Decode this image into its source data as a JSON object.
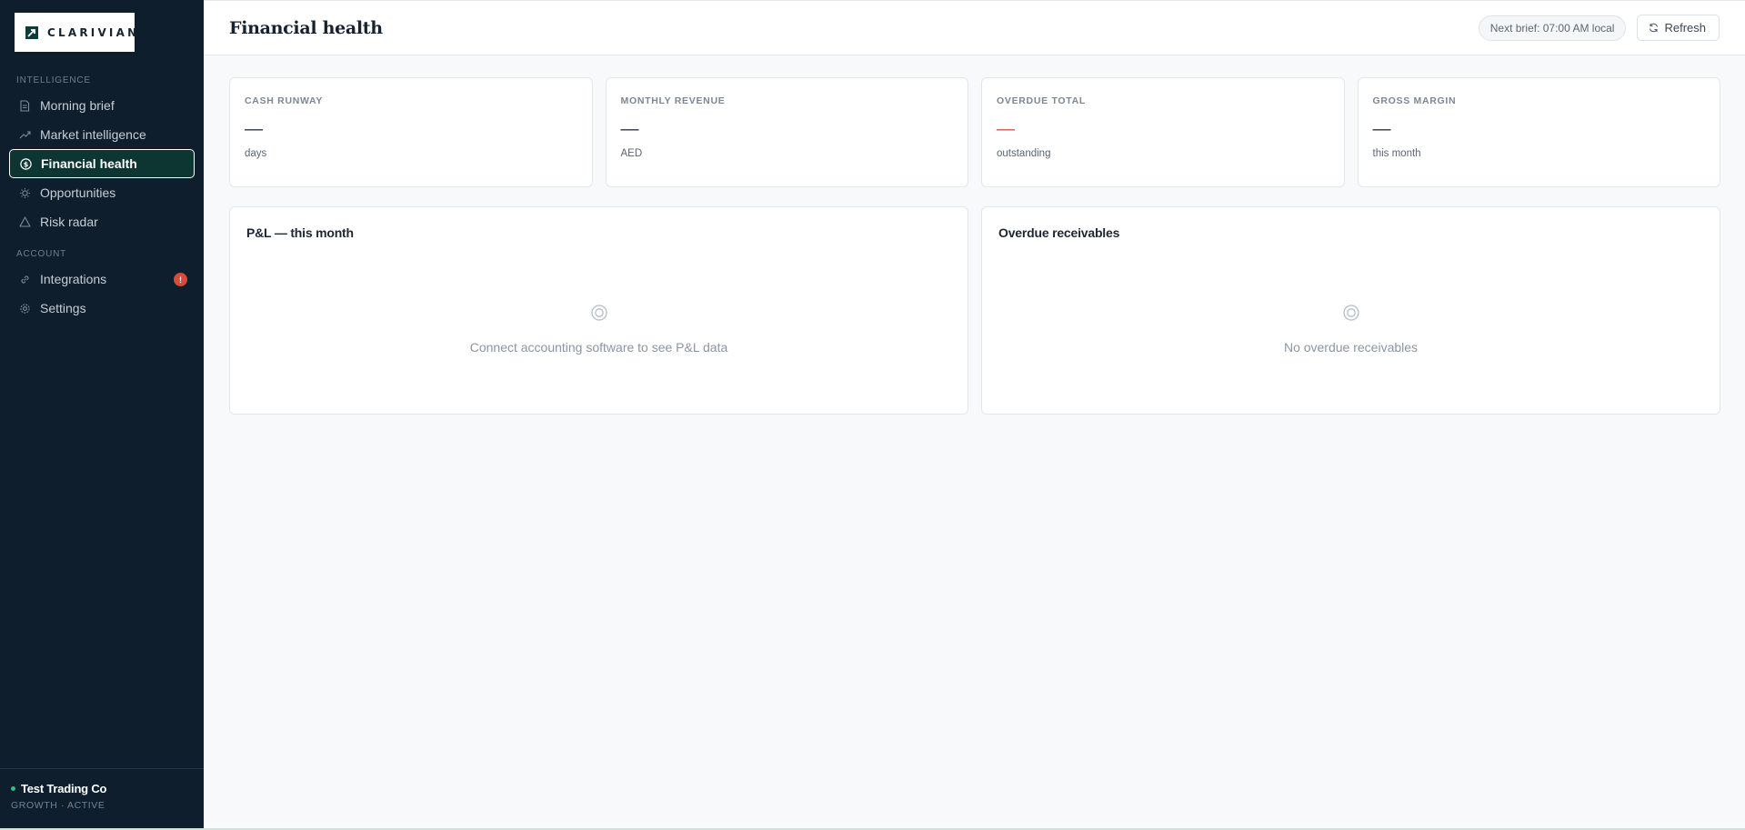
{
  "brand": {
    "name": "CLARIVIAN"
  },
  "sidebar": {
    "sections": {
      "intelligence": "INTELLIGENCE",
      "account": "ACCOUNT"
    },
    "items": [
      {
        "label": "Morning brief",
        "icon": "document-icon"
      },
      {
        "label": "Market intelligence",
        "icon": "trend-up-icon"
      },
      {
        "label": "Financial health",
        "icon": "dollar-circle-icon",
        "active": true
      },
      {
        "label": "Opportunities",
        "icon": "lightbulb-icon"
      },
      {
        "label": "Risk radar",
        "icon": "warning-triangle-icon"
      },
      {
        "label": "Integrations",
        "icon": "link-icon",
        "badge": "!"
      },
      {
        "label": "Settings",
        "icon": "gear-icon"
      }
    ],
    "footer": {
      "org_name": "Test Trading Co",
      "plan": "GROWTH · ACTIVE"
    }
  },
  "header": {
    "title": "Financial health",
    "next_brief": "Next brief: 07:00 AM local",
    "refresh_label": "Refresh"
  },
  "stats": [
    {
      "label": "CASH RUNWAY",
      "value": "—",
      "sub": "days"
    },
    {
      "label": "MONTHLY REVENUE",
      "value": "—",
      "sub": "AED"
    },
    {
      "label": "OVERDUE TOTAL",
      "value": "—",
      "sub": "outstanding",
      "accent": "#d0594b"
    },
    {
      "label": "GROSS MARGIN",
      "value": "—",
      "sub": "this month"
    }
  ],
  "panels": {
    "pnl": {
      "title": "P&L — this month",
      "empty_text": "Connect accounting software to see P&L data"
    },
    "receivables": {
      "title": "Overdue receivables",
      "empty_text": "No overdue receivables"
    }
  },
  "colors": {
    "sidebar_bg": "#0f1e2c",
    "active_bg": "#0d3531",
    "badge": "#d64b3b",
    "status_dot": "#2bbf85"
  }
}
